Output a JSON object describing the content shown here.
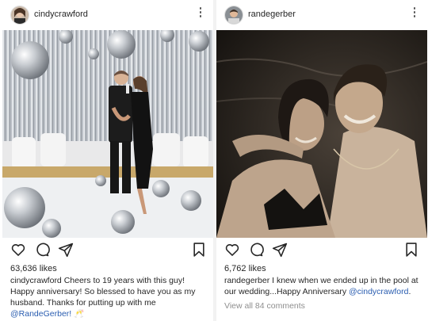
{
  "left_post": {
    "username": "cindycrawford",
    "likes": "63,636 likes",
    "caption_user": "cindycrawford",
    "caption_text": " Cheers to 19 years with this guy! Happy anniversary! So blessed to have you as my husband. Thanks for putting up with me ",
    "caption_mention": "@RandeGerber!",
    "caption_emoji": "🥂",
    "icons": [
      "heart-icon",
      "comment-icon",
      "share-icon",
      "bookmark-icon"
    ]
  },
  "right_post": {
    "username": "randegerber",
    "likes": "6,762 likes",
    "caption_user": "randegerber",
    "caption_text": " I knew when we ended up in the pool at our wedding...Happy Anniversary ",
    "caption_mention": "@cindycrawford",
    "caption_end": ".",
    "comments_link": "View all 84 comments",
    "icons": [
      "heart-icon",
      "comment-icon",
      "share-icon",
      "bookmark-icon"
    ]
  },
  "colors": {
    "text": "#262626",
    "mention": "#2a5db0",
    "muted": "#8e8e8e"
  }
}
